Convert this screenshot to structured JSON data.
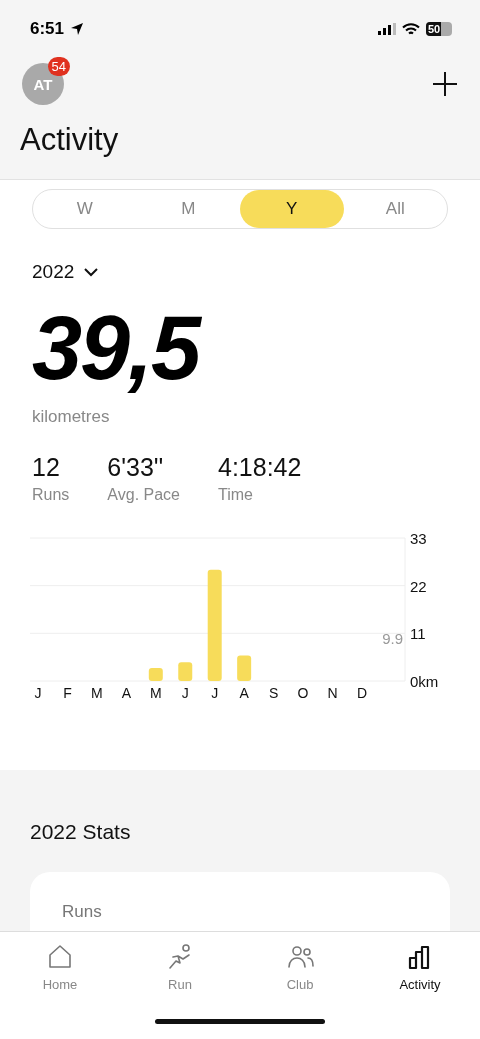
{
  "status_bar": {
    "time": "6:51",
    "battery": "50"
  },
  "header": {
    "avatar_initials": "AT",
    "notification_count": "54",
    "title": "Activity"
  },
  "period_tabs": [
    {
      "label": "W",
      "selected": false
    },
    {
      "label": "M",
      "selected": false
    },
    {
      "label": "Y",
      "selected": true
    },
    {
      "label": "All",
      "selected": false
    }
  ],
  "year_selector": {
    "value": "2022"
  },
  "total": {
    "value": "39,5",
    "unit": "kilometres"
  },
  "stats": [
    {
      "value": "12",
      "label": "Runs"
    },
    {
      "value": "6'33''",
      "label": "Avg. Pace"
    },
    {
      "value": "4:18:42",
      "label": "Time"
    }
  ],
  "chart_data": {
    "type": "bar",
    "categories": [
      "J",
      "F",
      "M",
      "A",
      "M",
      "J",
      "J",
      "A",
      "S",
      "O",
      "N",
      "D"
    ],
    "series": [
      {
        "color": "#f7dc5a",
        "values": [
          0,
          0,
          0,
          0,
          3.0,
          4.3,
          25.7,
          5.9,
          0,
          0,
          0,
          0
        ]
      }
    ],
    "ylim": [
      0,
      33
    ],
    "yticks": [
      {
        "value": 0,
        "label": "0km"
      },
      11,
      22,
      33
    ]
  },
  "chart_average_label": "9.9",
  "stats_section": {
    "title": "2022 Stats",
    "card_label": "Runs"
  },
  "bottom_tabs": [
    {
      "label": "Home",
      "selected": false
    },
    {
      "label": "Run",
      "selected": false
    },
    {
      "label": "Club",
      "selected": false
    },
    {
      "label": "Activity",
      "selected": true
    }
  ]
}
